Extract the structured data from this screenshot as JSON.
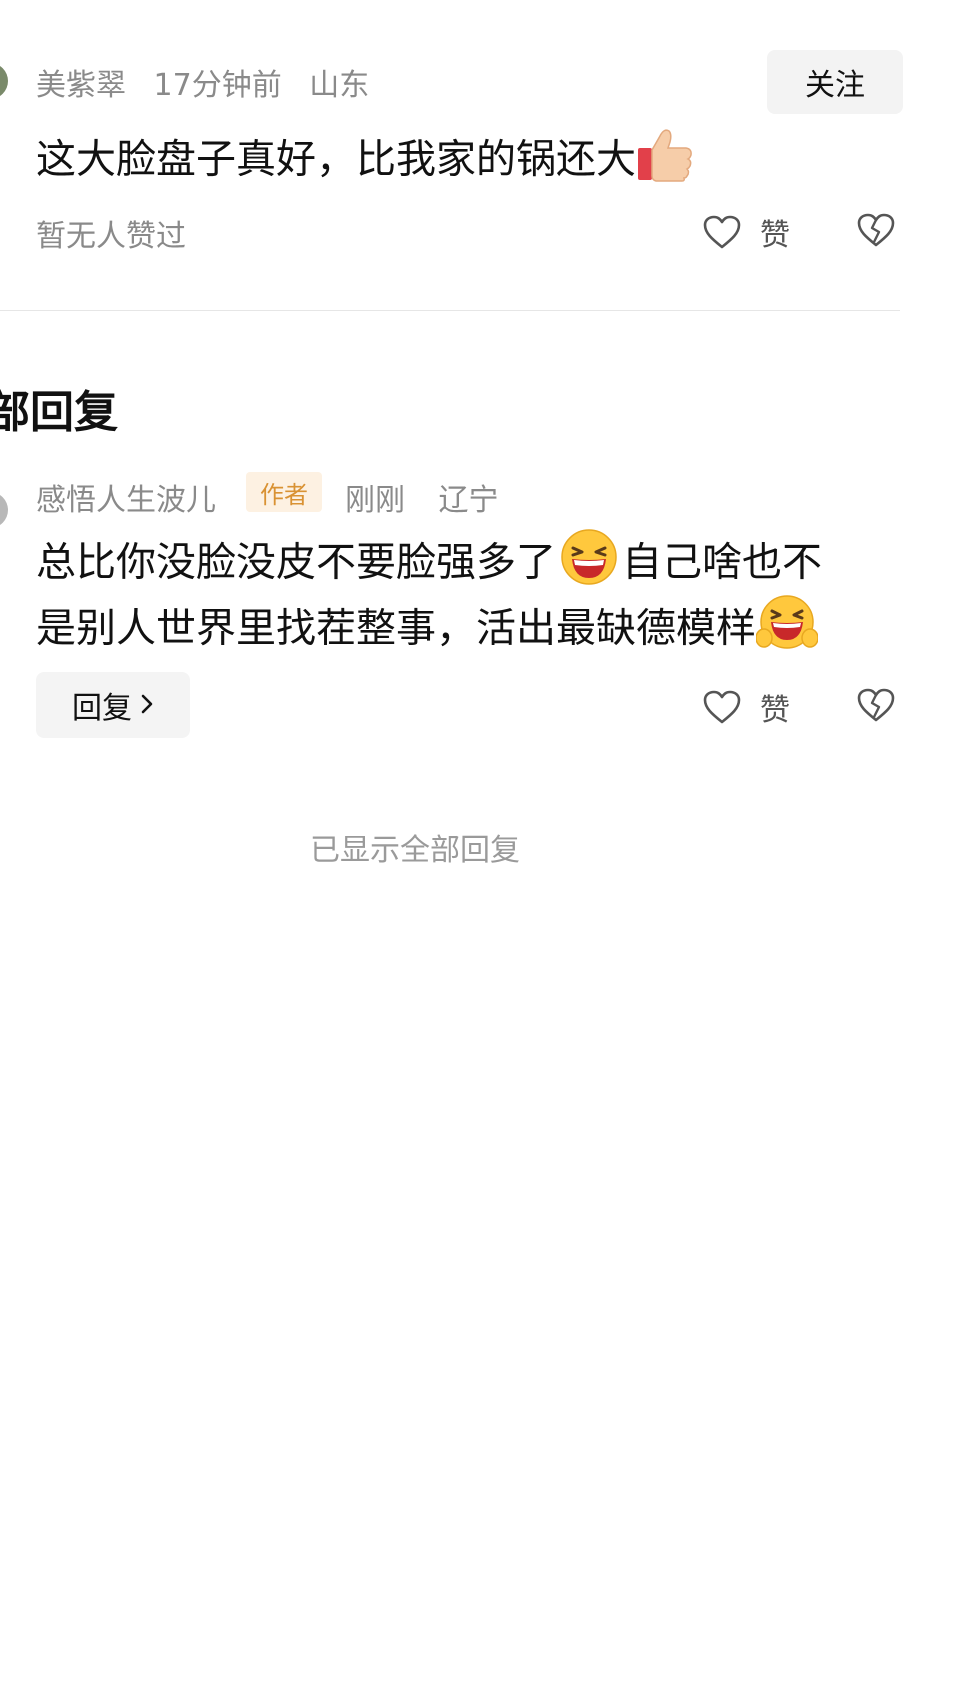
{
  "comment": {
    "username": "美紫翠",
    "time": "17分钟前",
    "location": "山东",
    "follow_label": "关注",
    "text": "这大脸盘子真好，比我家的锅还大",
    "emoji": "thumbs-up",
    "no_likes": "暂无人赞过",
    "like_label": "赞"
  },
  "replies_section": {
    "title": "部回复"
  },
  "reply": {
    "username": "感悟人生波儿",
    "author_tag": "作者",
    "time": "刚刚",
    "location": "辽宁",
    "text_line1a": "总比你没脸没皮不要脸强多了",
    "text_line1b": "自己啥也不",
    "text_line2": "是别人世界里找茬整事，活出最缺德模样",
    "emoji1": "laughing-face",
    "emoji2": "laughing-hug-face",
    "reply_button": "回复",
    "like_label": "赞"
  },
  "footer": {
    "all_shown": "已显示全部回复"
  },
  "colors": {
    "meta_gray": "#8a8a8a",
    "author_tag_bg": "#fdf1e2",
    "author_tag_text": "#d99233",
    "button_bg": "#f3f3f3"
  }
}
